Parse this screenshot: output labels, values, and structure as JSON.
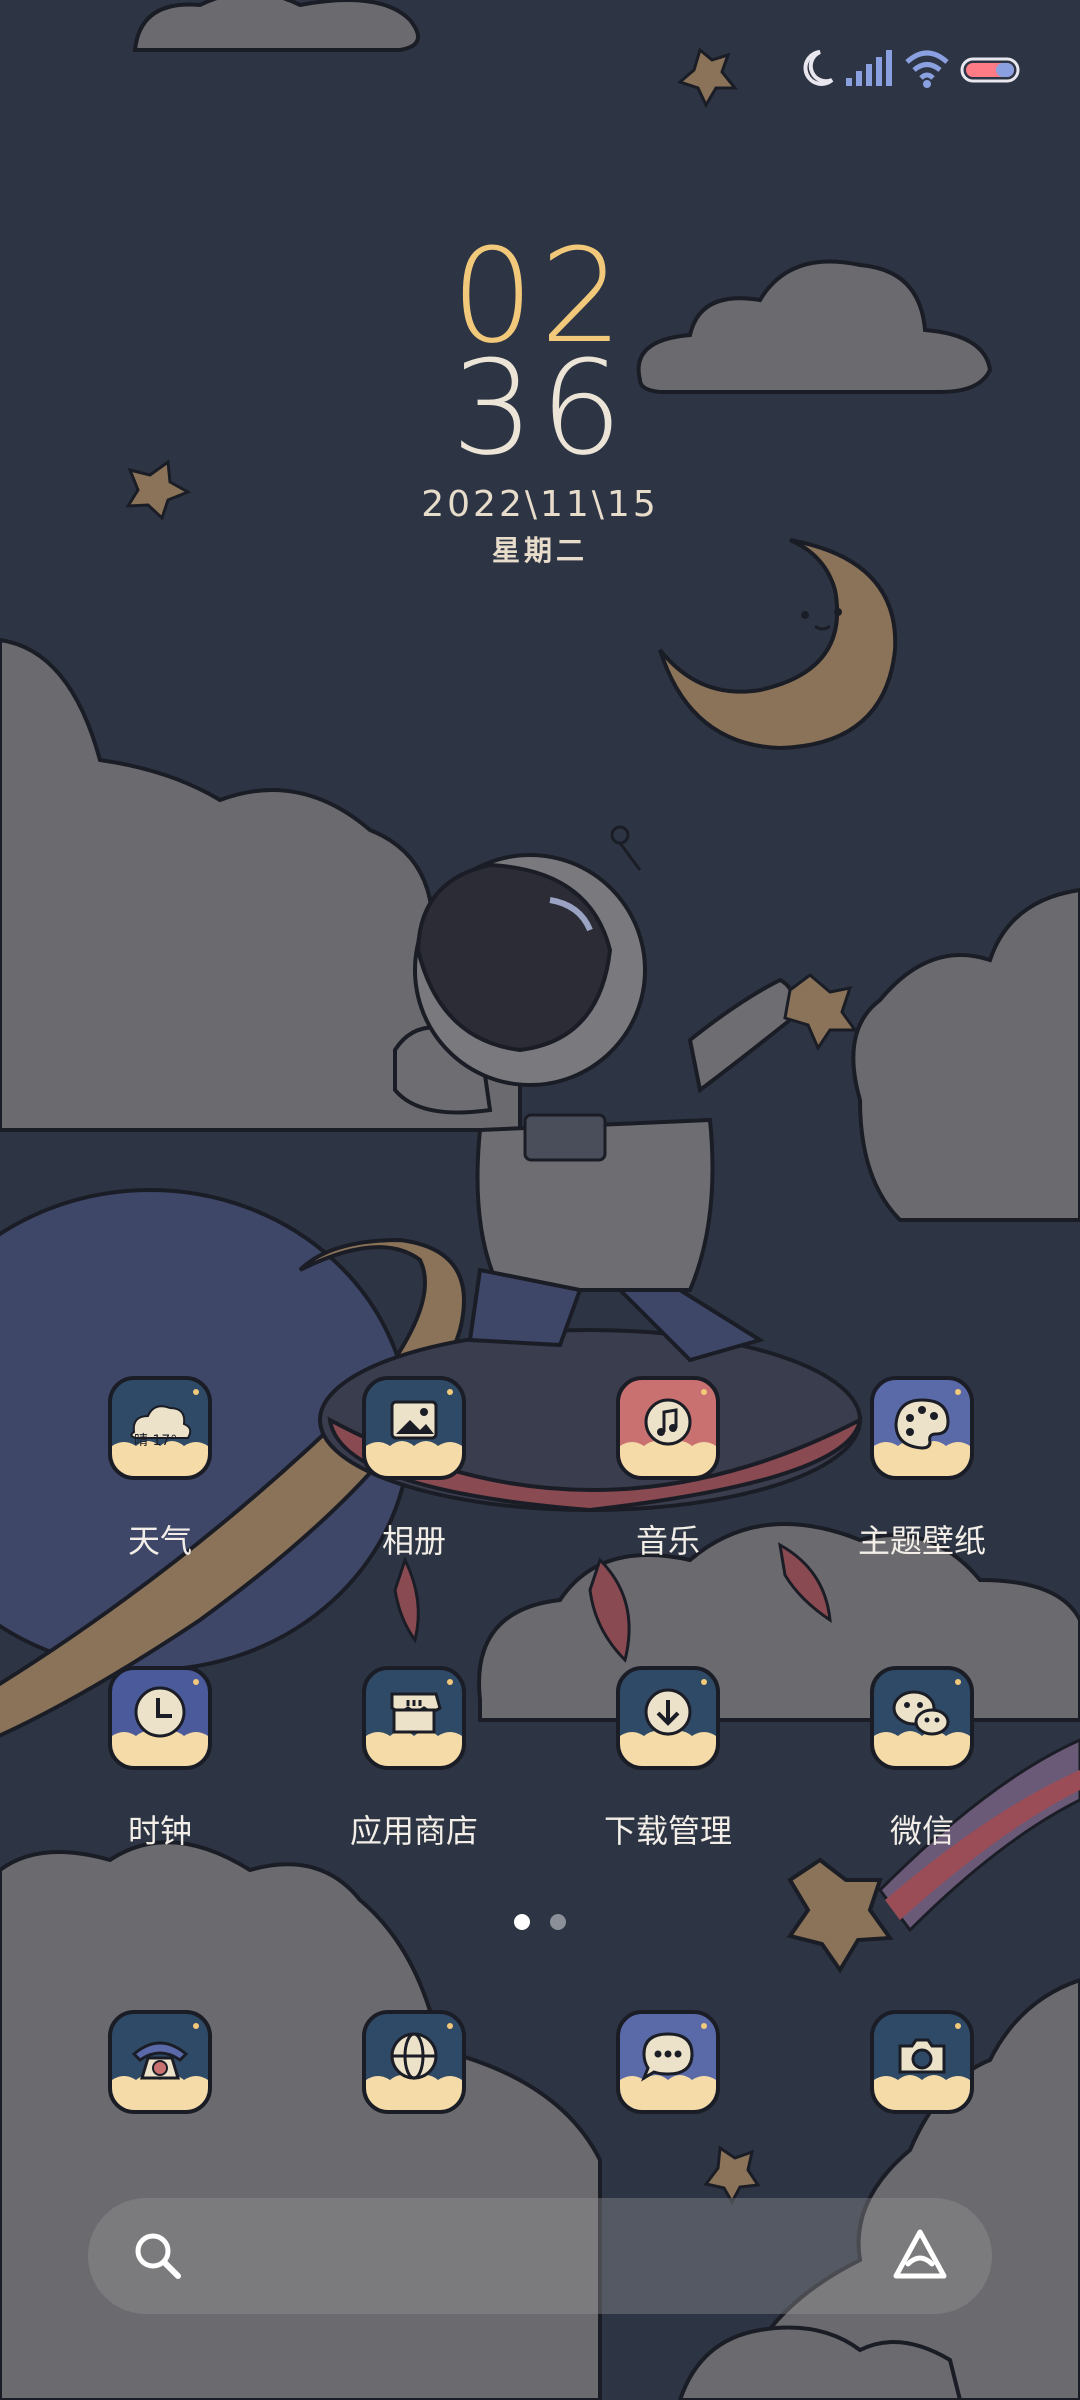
{
  "status_bar": {
    "icons": [
      "do-not-disturb-moon-icon",
      "cellular-signal-icon",
      "wifi-icon",
      "battery-icon"
    ],
    "battery_color": "#ff7b85"
  },
  "clock": {
    "hours": "02",
    "minutes": "36",
    "date": "2022\\11\\15",
    "weekday": "星期二"
  },
  "apps": {
    "row1": [
      {
        "label": "天气",
        "icon": "weather-icon",
        "bg": "#2f4a66",
        "weather_text": "晴 17°"
      },
      {
        "label": "相册",
        "icon": "gallery-icon",
        "bg": "#2f4a66"
      },
      {
        "label": "音乐",
        "icon": "music-icon",
        "bg": "#c97070"
      },
      {
        "label": "主题壁纸",
        "icon": "themes-palette-icon",
        "bg": "#5a6aa8"
      }
    ],
    "row2": [
      {
        "label": "时钟",
        "icon": "clock-icon",
        "bg": "#4a5a9a"
      },
      {
        "label": "应用商店",
        "icon": "app-store-icon",
        "bg": "#2f4a66"
      },
      {
        "label": "下载管理",
        "icon": "download-icon",
        "bg": "#2f4a66"
      },
      {
        "label": "微信",
        "icon": "wechat-icon",
        "bg": "#2f4a66"
      }
    ]
  },
  "dock": [
    {
      "icon": "phone-icon",
      "bg": "#2f4a66"
    },
    {
      "icon": "browser-icon",
      "bg": "#2f4a66"
    },
    {
      "icon": "messages-icon",
      "bg": "#5a6aa8"
    },
    {
      "icon": "camera-icon",
      "bg": "#2f4a66"
    }
  ],
  "page_indicator": {
    "pages": 2,
    "active": 1
  },
  "search": {
    "left_icon": "search-icon",
    "right_icon": "assistant-icon"
  },
  "colors": {
    "sky": "#2d3544",
    "cloud": "#6b6b6f",
    "accent_hour": "#f2c97a",
    "icon_cream": "#f5dba8"
  }
}
